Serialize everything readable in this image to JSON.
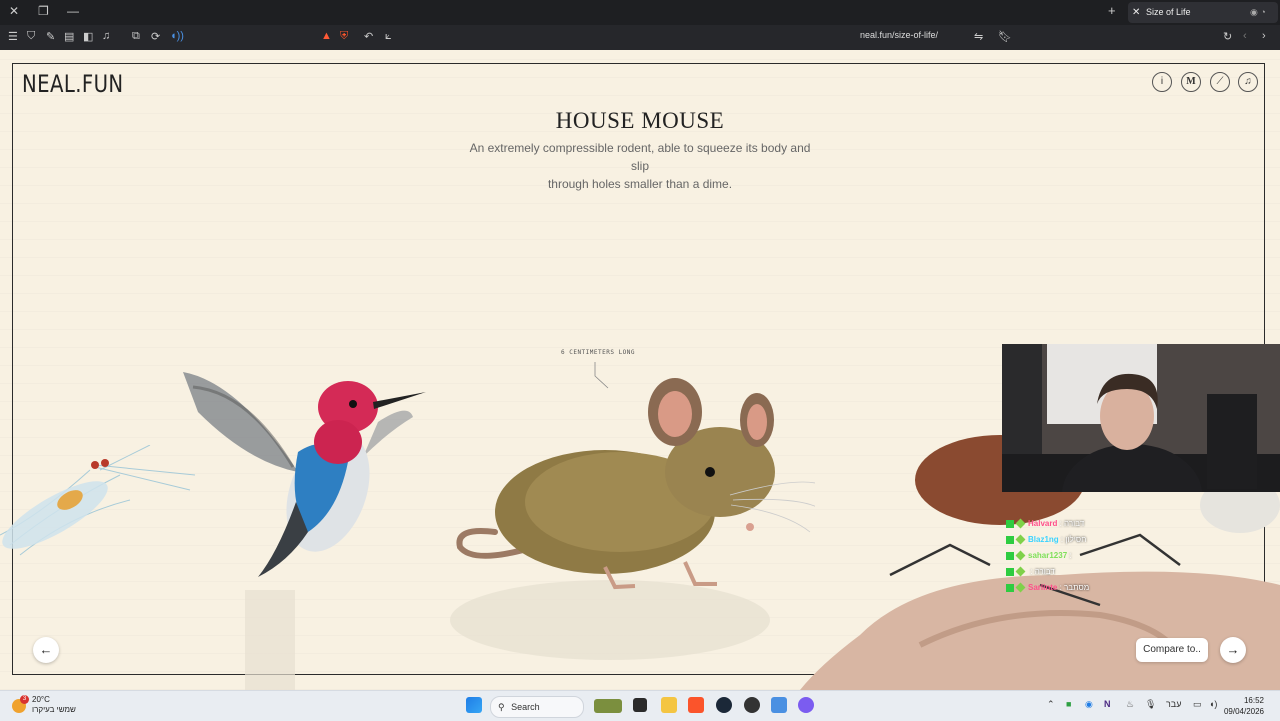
{
  "browser": {
    "tab_title": "Size of Life",
    "url": "neal.fun/size-of-life/"
  },
  "page": {
    "logo": "NEAL.FUN",
    "title": "HOUSE MOUSE",
    "description_line1": "An extremely compressible rodent, able to squeeze its body and slip",
    "description_line2": "through holes smaller than a dime.",
    "measurement_label": "6 CENTIMETERS LONG",
    "tools": [
      "info-icon",
      "medium-icon",
      "ruler-icon",
      "music-icon"
    ],
    "prev_label": "←",
    "next_label": "→",
    "compare_label": "Compare to..",
    "creatures": [
      "krill",
      "bee hummingbird",
      "house mouse",
      "beetle on hand"
    ]
  },
  "stream_overlay": {
    "chat": [
      {
        "user": "Halvard",
        "message": ": דבורה",
        "color": "#ff4f8b"
      },
      {
        "user": "Blaz1ng",
        "message": ": חסילון",
        "color": "#3ad3ff"
      },
      {
        "user": "sahar1237",
        "message": ":",
        "color": "#7fe05a"
      },
      {
        "user": "",
        "message": ": דבורה",
        "color": "#3ad3ff"
      },
      {
        "user": "Sarlinte",
        "message": ": מסתבר",
        "color": "#ff4f8b"
      }
    ]
  },
  "taskbar": {
    "weather_temp": "20°C",
    "weather_desc": "שמשי בעיקרו",
    "weather_badge": "3",
    "search_label": "Search",
    "language": "עבר",
    "time": "16:52",
    "date": "09/04/2026"
  },
  "colors": {
    "page_bg": "#f8f1e2",
    "chrome_bg": "#1e1f22"
  }
}
